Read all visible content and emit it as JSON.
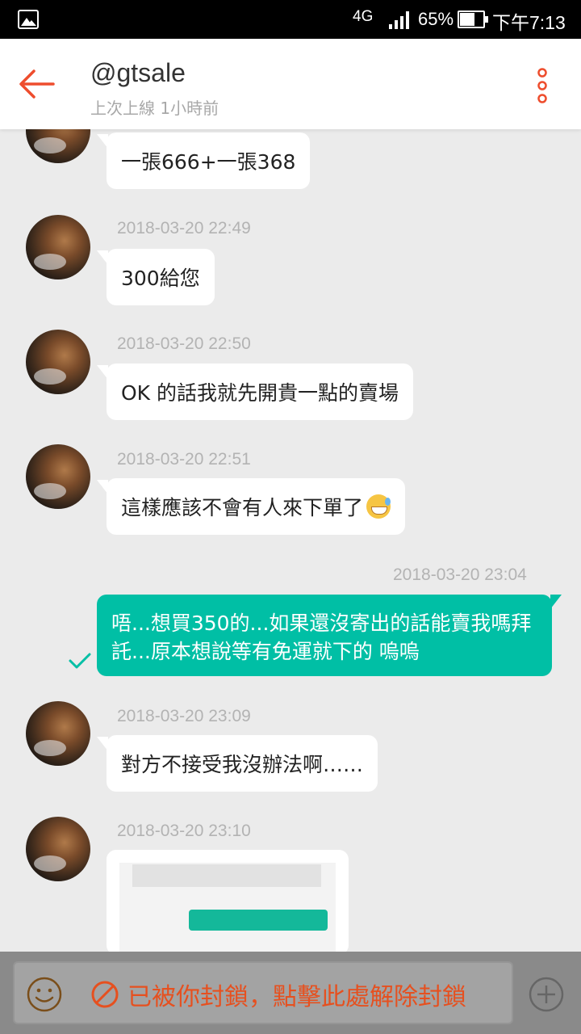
{
  "status_bar": {
    "network": "4G",
    "battery": "65%",
    "time": "下午7:13"
  },
  "header": {
    "title": "@gtsale",
    "subtitle": "上次上線 1小時前"
  },
  "messages": [
    {
      "text": "一張666+一張368"
    },
    {
      "time": "2018-03-20 22:49",
      "text": "300給您"
    },
    {
      "time": "2018-03-20 22:50",
      "text": "OK 的話我就先開貴一點的賣場"
    },
    {
      "time": "2018-03-20 22:51",
      "text": "這樣應該不會有人來下單了"
    },
    {
      "time": "2018-03-20 23:04",
      "text": "唔...想買350的...如果還沒寄出的話能賣我嗎拜託...原本想說等有免運就下的 嗚嗚"
    },
    {
      "time": "2018-03-20 23:09",
      "text": "對方不接受我沒辦法啊……"
    },
    {
      "time": "2018-03-20 23:10"
    }
  ],
  "bottom_bar": {
    "blocked_text": "已被你封鎖，點擊此處解除封鎖"
  },
  "colors": {
    "accent": "#ee4d2d",
    "outgoing_bubble": "#00bfa5",
    "background": "#ebebeb"
  },
  "icons": [
    "image-icon",
    "back-arrow-icon",
    "more-icon",
    "sent-check-icon",
    "smile-icon",
    "block-icon",
    "plus-icon"
  ]
}
